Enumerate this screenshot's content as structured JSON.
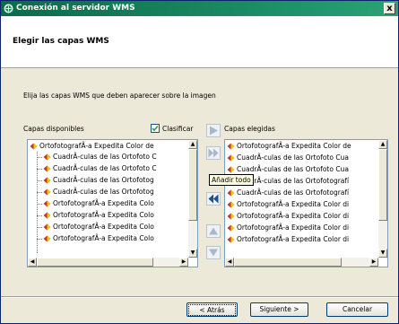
{
  "window": {
    "title": "Conexión al servidor WMS",
    "close_label": "x"
  },
  "header": {
    "title": "Elegir las capas WMS"
  },
  "instructions": "Elija las capas WMS que deben aparecer sobre la imagen",
  "available": {
    "label": "Capas disponibles",
    "sort_label": "Clasificar",
    "sort_checked": true,
    "items": [
      "OrtofotografÃ-a Expedita Color de",
      "CuadrÃ-culas de las Ortofoto C",
      "CuadrÃ-culas de las Ortofoto C",
      "CuadrÃ-culas de las Ortofotog",
      "CuadrÃ-culas de las Ortofotog",
      "OrtofotografÃ-a Expedita Colo",
      "OrtofotografÃ-a Expedita Colo",
      "OrtofotografÃ-a Expedita Colo",
      "OrtofotografÃ-a Expedita Colo"
    ]
  },
  "selected": {
    "label": "Capas elegidas",
    "items": [
      "OrtofotografÃ-a Expedita Color de",
      "CuadrÃ-culas de las Ortofoto Cua",
      "CuadrÃ-culas de las Ortofoto Cua",
      "CuadrÃ-culas de las Ortofotografí",
      "CuadrÃ-culas de las Ortofotografí",
      "OrtofotografÃ-a Expedita Color di",
      "OrtofotografÃ-a Expedita Color di",
      "OrtofotografÃ-a Expedita Color di",
      "OrtofotografÃ-a Expedita Color di"
    ]
  },
  "tooltip": "Añadir todo",
  "buttons": {
    "back": "< Atrás",
    "next": "Siguiente >",
    "cancel": "Cancelar"
  },
  "colors": {
    "titlebar": "#0a6b4a",
    "arrow_enabled": "#1f4e9a",
    "arrow_disabled": "#a9b8c8"
  }
}
